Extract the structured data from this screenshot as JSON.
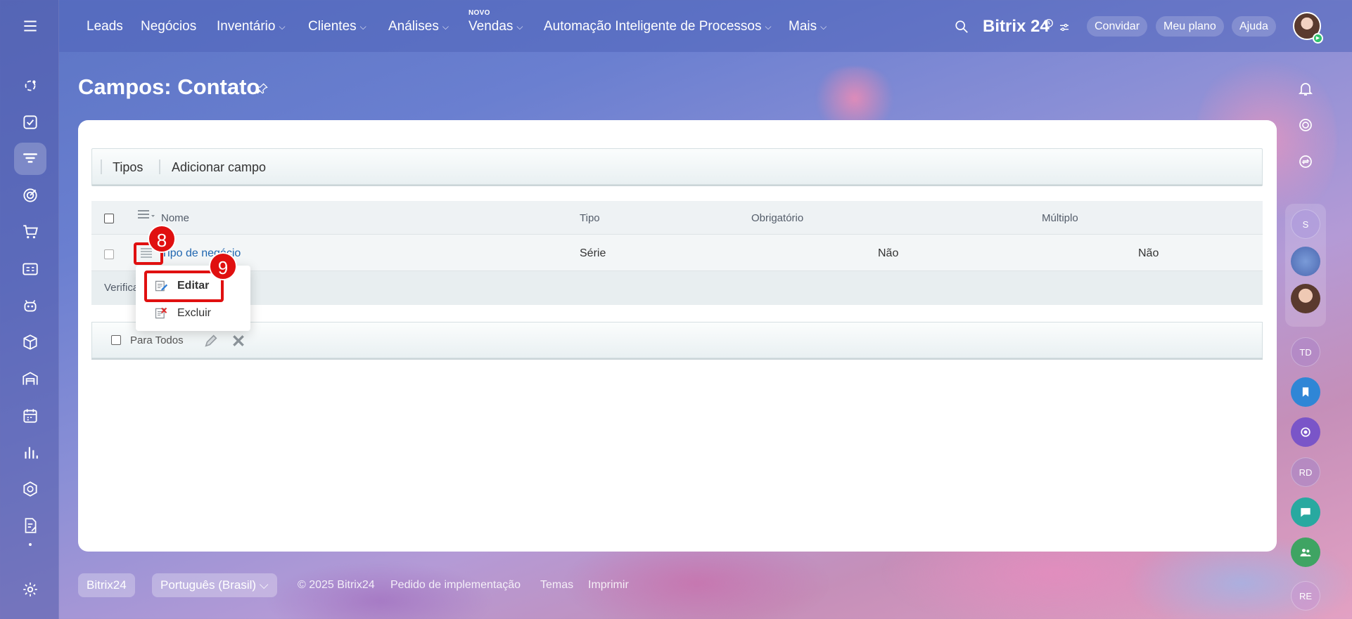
{
  "top_nav": {
    "items": [
      {
        "label": "Leads",
        "dropdown": false
      },
      {
        "label": "Negócios",
        "dropdown": false
      },
      {
        "label": "Inventário",
        "dropdown": true
      },
      {
        "label": "Clientes",
        "dropdown": true
      },
      {
        "label": "Análises",
        "dropdown": true
      },
      {
        "label": "Vendas",
        "dropdown": true
      },
      {
        "label": "Automação Inteligente de Processos",
        "dropdown": true
      },
      {
        "label": "Mais",
        "dropdown": true
      }
    ],
    "novo_badge": "NOVO",
    "chevron": "⌵",
    "brand": "Bitrix 24",
    "invite_label": "Convidar",
    "plan_label": "Meu plano",
    "help_label": "Ajuda"
  },
  "page": {
    "title": "Campos: Contato"
  },
  "toolbar": {
    "types_label": "Tipos",
    "add_field_label": "Adicionar campo"
  },
  "grid": {
    "columns": [
      "Nome",
      "Tipo",
      "Obrigatório",
      "Múltiplo"
    ],
    "rows": [
      {
        "name": "Tipo de negócio",
        "type": "Série",
        "required": "Não",
        "multiple": "Não"
      }
    ],
    "footer_text": "Verifica"
  },
  "actions_bar": {
    "for_all_label": "Para Todos"
  },
  "context_menu": {
    "edit_label": "Editar",
    "delete_label": "Excluir"
  },
  "annotations": {
    "step_8": "8",
    "step_9": "9"
  },
  "right_sidebar": {
    "avatars": [
      "S",
      "TD",
      "RD",
      "RE"
    ]
  },
  "footer": {
    "brand_label": "Bitrix24",
    "language_label": "Português (Brasil)",
    "copyright": "© 2025 Bitrix24",
    "link_implementation": "Pedido de implementação",
    "link_themes": "Temas",
    "link_print": "Imprimir"
  },
  "colors": {
    "accent_link": "#2067b0",
    "annotation_red": "#e01010",
    "online_green": "#2fc26b"
  }
}
